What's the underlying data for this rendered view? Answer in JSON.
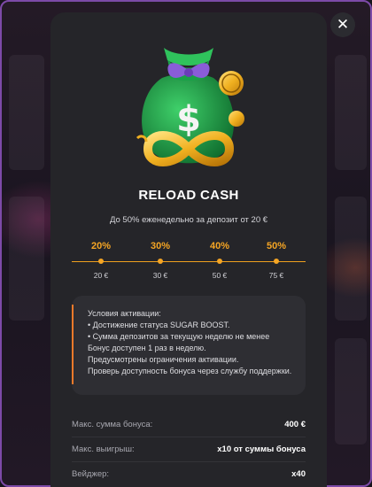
{
  "modal": {
    "title": "RELOAD CASH",
    "subtitle": "До 50% еженедельно за депозит от 20 €",
    "close_icon": "close-icon",
    "hero_icon": "money-bag-infinity-icon"
  },
  "steps": [
    {
      "percent": "20%",
      "amount": "20 €"
    },
    {
      "percent": "30%",
      "amount": "30 €"
    },
    {
      "percent": "40%",
      "amount": "50 €"
    },
    {
      "percent": "50%",
      "amount": "75 €"
    }
  ],
  "conditions": {
    "lines": [
      "Условия активации:",
      "• Достижение статуса SUGAR BOOST.",
      "• Сумма депозитов за текущую неделю не менее",
      "Бонус доступен 1 раз в неделю.",
      "Предусмотрены ограничения активации.",
      "Проверь доступность бонуса через службу поддержки."
    ]
  },
  "info": [
    {
      "label": "Макс. сумма бонуса:",
      "value": "400 €"
    },
    {
      "label": "Макс. выигрыш:",
      "value": "x10 от суммы бонуса"
    },
    {
      "label": "Вейджер:",
      "value": "x40"
    }
  ],
  "colors": {
    "accent": "#f5a524",
    "panel": "#252529",
    "frame": "#7d4aa8"
  }
}
